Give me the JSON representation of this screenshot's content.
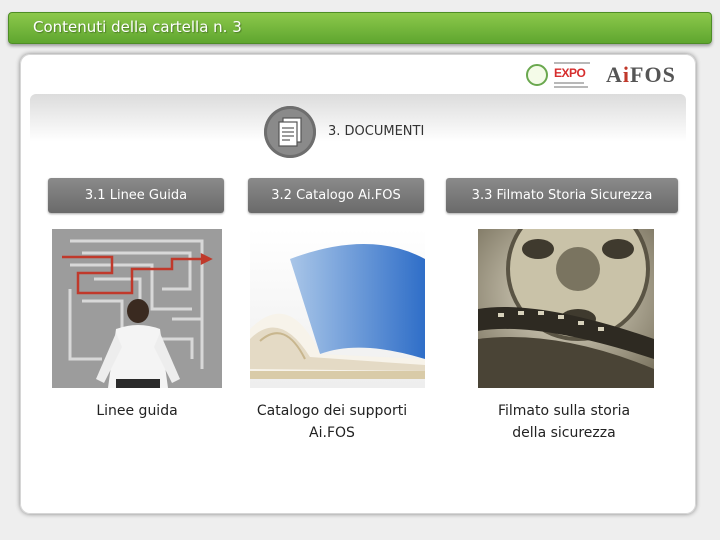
{
  "header": {
    "title": "Contenuti della cartella n. 3"
  },
  "logos": {
    "expo": {
      "text": "EXPO",
      "icon": "expo-logo-icon"
    },
    "aifos": {
      "text_before": "A",
      "text_dot": "i",
      "text_after": "FOS",
      "icon": "aifos-logo-icon"
    }
  },
  "section": {
    "heading": "3. DOCUMENTI",
    "icon": "document-icon"
  },
  "tabs": [
    {
      "label": "3.1 Linee Guida"
    },
    {
      "label": "3.2 Catalogo Ai.FOS"
    },
    {
      "label": "3.3 Filmato Storia Sicurezza"
    }
  ],
  "items": [
    {
      "image": "maze-businessman-image",
      "caption_line1": "Linee guida",
      "caption_line2": ""
    },
    {
      "image": "open-catalog-image",
      "caption_line1": "Catalogo dei supporti",
      "caption_line2": "Ai.FOS"
    },
    {
      "image": "film-reel-image",
      "caption_line1": "Filmato sulla storia",
      "caption_line2": "della sicurezza"
    }
  ],
  "colors": {
    "title_bar": "#6fb33a",
    "tab_background": "#7a7a7a",
    "aifos_dot": "#c0392b",
    "expo_red": "#d62d2d"
  }
}
